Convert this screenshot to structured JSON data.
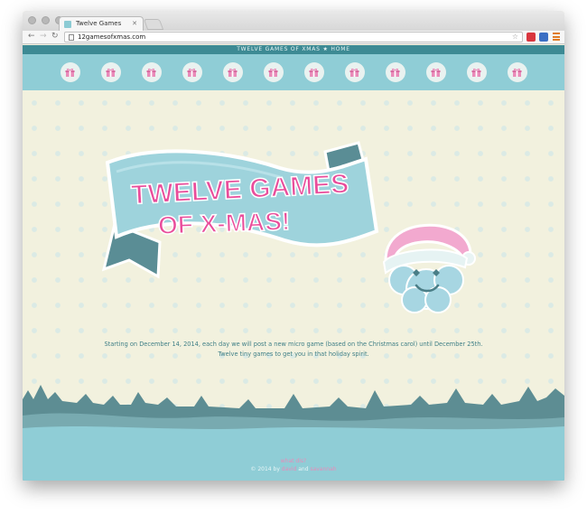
{
  "browser": {
    "tab_title": "Twelve Games",
    "url": "12gamesofxmas.com"
  },
  "site": {
    "nav": {
      "title": "TWELVE GAMES OF XMAS",
      "separator": "★",
      "home": "HOME"
    },
    "gift_count": 12,
    "banner": {
      "line1": "TWELVE GAMES",
      "line2": "OF X-MAS!"
    },
    "intro_line1": "Starting on December 14, 2014, each day we will post a new micro game (based on the Christmas carol) until December 25th.",
    "intro_line2": "Twelve tiny games to get you in that holiday spirit.",
    "footer": {
      "what_link": "what dis?",
      "copyright_prefix": "© 2014 by",
      "author1": "david",
      "and": "and",
      "author2": "savannah"
    }
  },
  "colors": {
    "teal_dark": "#3d8a94",
    "teal_light": "#8fcdd6",
    "cream": "#f2f1de",
    "pink": "#e98bb9"
  }
}
